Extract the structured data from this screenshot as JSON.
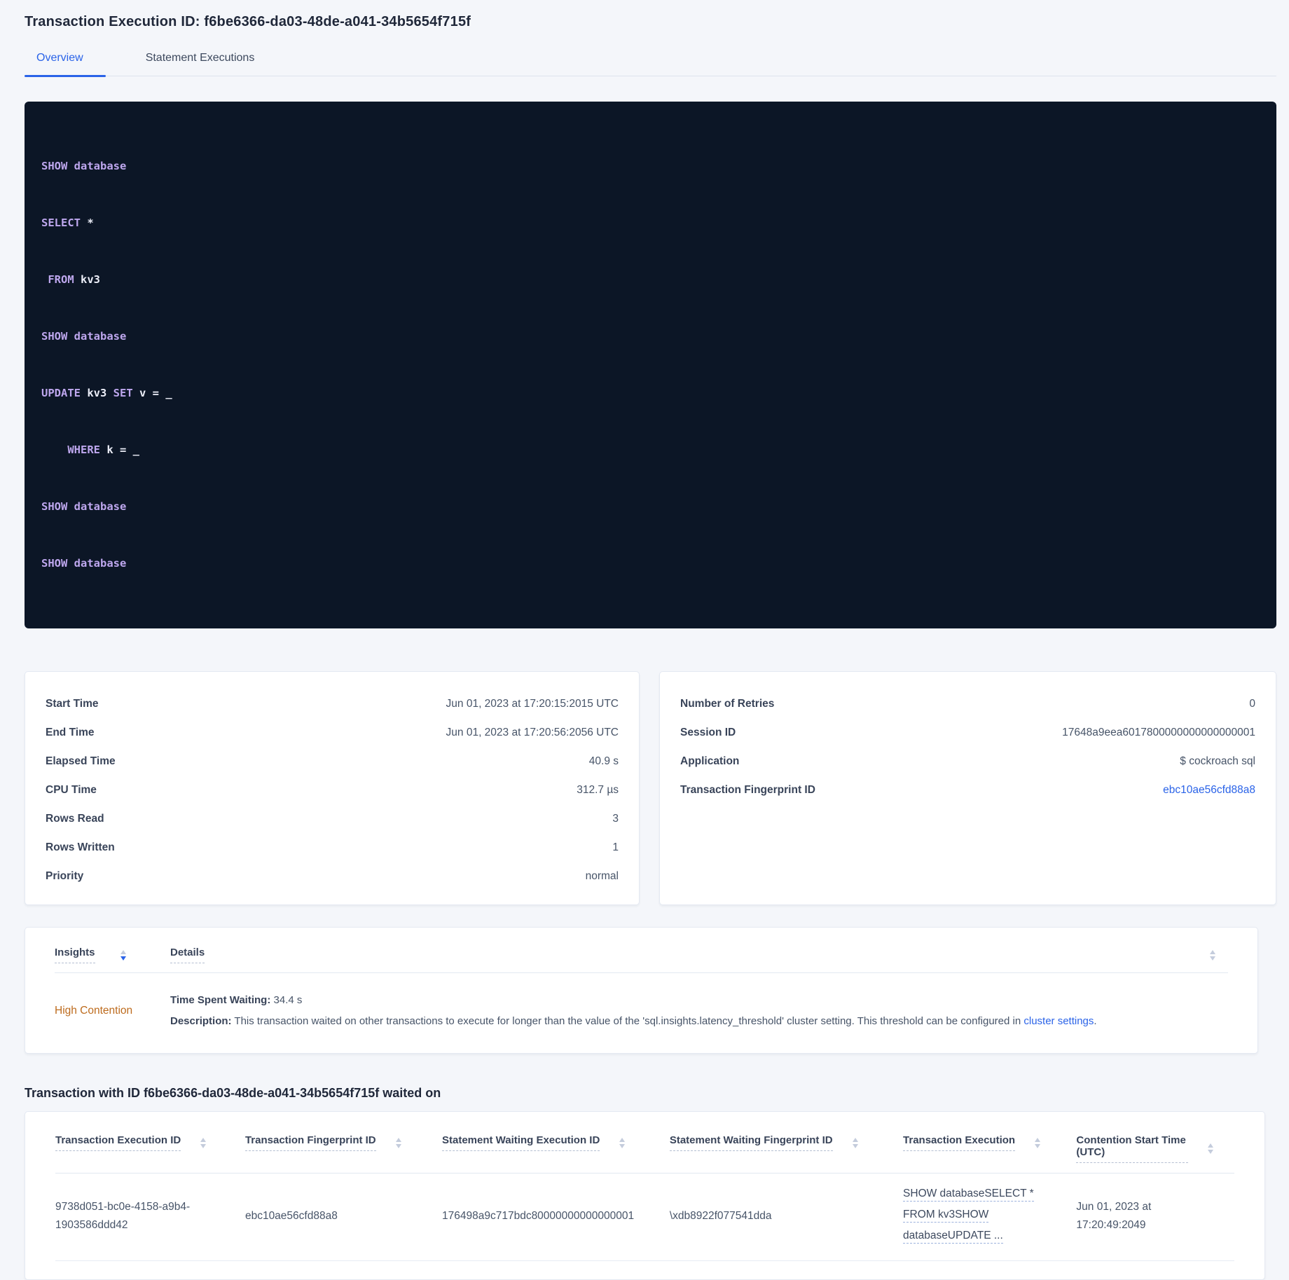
{
  "colors": {
    "accent_blue": "#2a63e8",
    "code_background": "#0c1626",
    "code_keyword": "#bea7ee",
    "code_plain": "#eceef8",
    "insight_warning": "#bd6b1d",
    "page_background": "#f4f6fa"
  },
  "header": {
    "title": "Transaction Execution ID: f6be6366-da03-48de-a041-34b5654f715f",
    "tabs": {
      "overview": "Overview",
      "statement_executions": "Statement Executions"
    }
  },
  "sql": {
    "lines": [
      {
        "s0": "SHOW database"
      },
      {
        "s0": "SELECT",
        "s1": " *"
      },
      {
        "s0": " FROM",
        "s1": " kv3"
      },
      {
        "s0": "SHOW database"
      },
      {
        "s0": "UPDATE",
        "s1": " kv3 ",
        "s2": "SET",
        "s3": " v = _"
      },
      {
        "s1": "    ",
        "s2": "WHERE",
        "s3": " k = _"
      },
      {
        "s0": "SHOW database"
      },
      {
        "s0": "SHOW database"
      }
    ]
  },
  "summary_left": {
    "rows": [
      {
        "label": "Start Time",
        "value": "Jun 01, 2023 at 17:20:15:2015 UTC"
      },
      {
        "label": "End Time",
        "value": "Jun 01, 2023 at 17:20:56:2056 UTC"
      },
      {
        "label": "Elapsed Time",
        "value": "40.9 s"
      },
      {
        "label": "CPU Time",
        "value": "312.7 µs"
      },
      {
        "label": "Rows Read",
        "value": "3"
      },
      {
        "label": "Rows Written",
        "value": "1"
      },
      {
        "label": "Priority",
        "value": "normal"
      }
    ]
  },
  "summary_right": {
    "rows": [
      {
        "label": "Number of Retries",
        "value": "0"
      },
      {
        "label": "Session ID",
        "value": "17648a9eea6017800000000000000001"
      },
      {
        "label": "Application",
        "value": "$ cockroach sql"
      }
    ],
    "fingerprint_label": "Transaction Fingerprint ID",
    "fingerprint_value": "ebc10ae56cfd88a8"
  },
  "insights": {
    "columns": {
      "insights": "Insights",
      "details": "Details"
    },
    "row": {
      "insight": "High Contention",
      "waiting_label": "Time Spent Waiting:",
      "waiting_value": " 34.4 s",
      "description_label": "Description:",
      "description_text": " This transaction waited on other transactions to execute for longer than the value of the 'sql.insights.latency_threshold' cluster setting. This threshold can be configured in ",
      "link": "cluster settings",
      "after_link": "."
    }
  },
  "waited": {
    "heading": "Transaction with ID f6be6366-da03-48de-a041-34b5654f715f waited on",
    "columns": [
      "Transaction Execution ID",
      "Transaction Fingerprint ID",
      "Statement Waiting Execution ID",
      "Statement Waiting Fingerprint ID",
      "Transaction Execution",
      "Contention Start Time (UTC)"
    ],
    "row": {
      "txn_execution_id": "9738d051-bc0e-4158-a9b4-1903586ddd42",
      "txn_fingerprint_id": "ebc10ae56cfd88a8",
      "stmt_waiting_execution_id": "176498a9c717bdc80000000000000001",
      "stmt_waiting_fingerprint_id": "\\xdb8922f077541dda",
      "txn_execution_lines": [
        "SHOW databaseSELECT *",
        "FROM kv3SHOW",
        "databaseUPDATE ..."
      ],
      "contention_start_time": "Jun 01, 2023 at 17:20:49:2049"
    }
  }
}
